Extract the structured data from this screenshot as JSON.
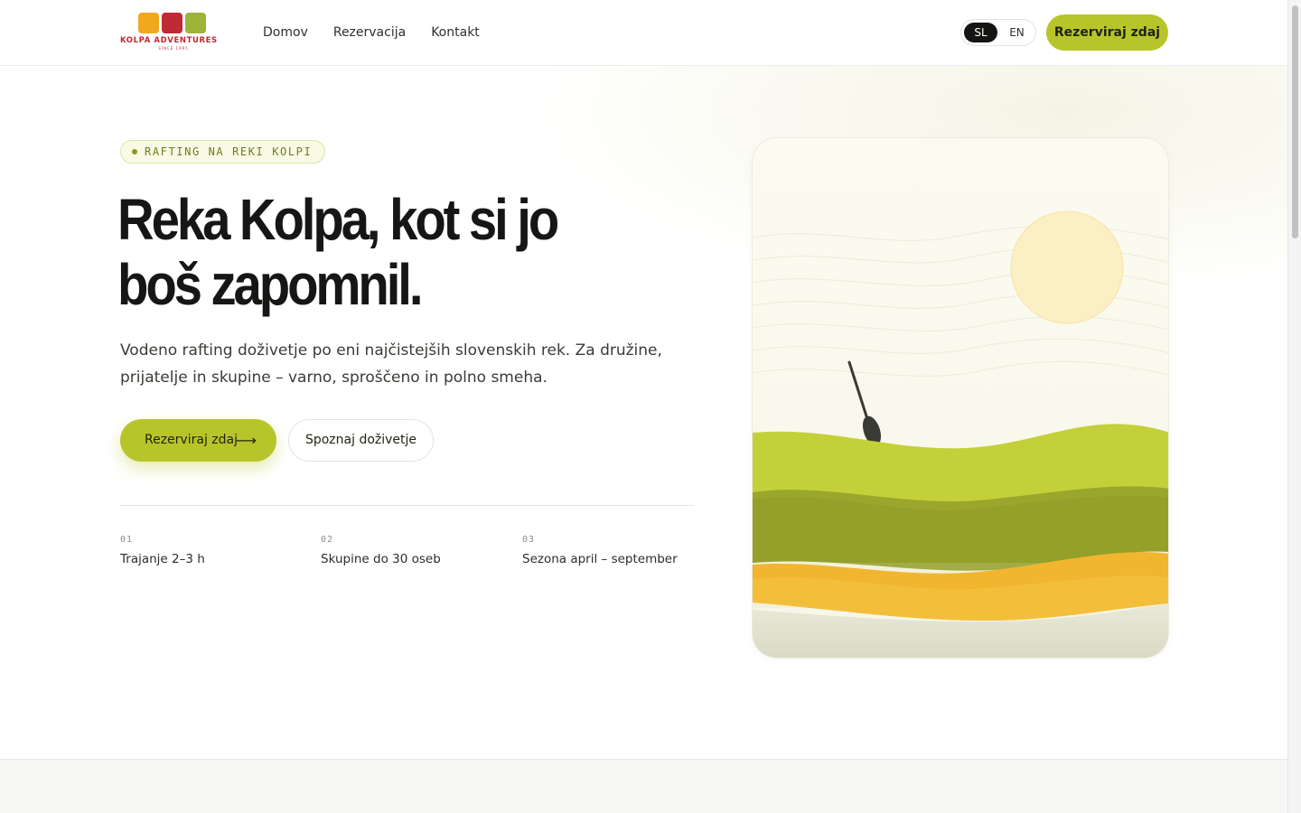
{
  "brand": {
    "name": "KOLPA ADVENTURES",
    "since": "SINCE 1995",
    "colors": {
      "orange": "#f2a81d",
      "red": "#c02a35",
      "green": "#9cb43a"
    }
  },
  "nav": {
    "items": [
      {
        "label": "Domov"
      },
      {
        "label": "Rezervacija"
      },
      {
        "label": "Kontakt"
      }
    ]
  },
  "language": {
    "options": [
      "SL",
      "EN"
    ],
    "selected": "SL"
  },
  "header": {
    "cta_label": "Rezerviraj zdaj"
  },
  "hero": {
    "badge": "RAFTING NA REKI KOLPI",
    "title_line1": "Reka Kolpa, kot si jo",
    "title_line2": "boš zapomnil.",
    "subtitle": "Vodeno rafting doživetje po eni najčistejših slovenskih rek. Za družine, prijatelje in skupine – varno, sproščeno in polno smeha.",
    "primary_cta": "Rezerviraj zdaj",
    "primary_cta_icon": "arrow-right-icon",
    "secondary_cta": "Spoznaj doživetje",
    "stats": [
      {
        "num": "01",
        "label": "Trajanje 2–3 h"
      },
      {
        "num": "02",
        "label": "Skupine do 30 oseb"
      },
      {
        "num": "03",
        "label": "Sezona april – september"
      }
    ]
  },
  "colors": {
    "accent": "#b8c52a",
    "text": "#161714",
    "sun": "#fbefc4",
    "hill_light": "#c3d039",
    "hill_dark": "#8f9b2a",
    "band_yellow": "#f1b52f"
  }
}
